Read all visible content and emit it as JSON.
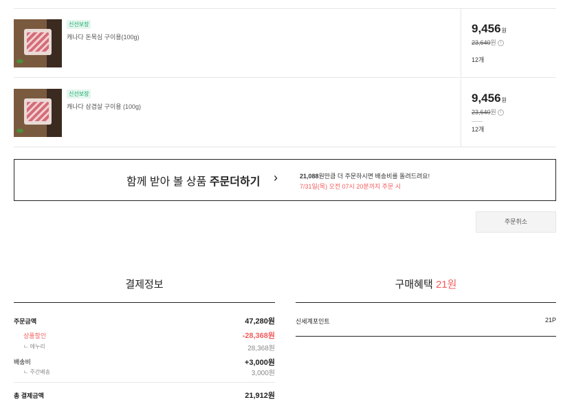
{
  "products": [
    {
      "badge": "신선보장",
      "name": "캐나다 돈목심 구이용(100g)",
      "price": "9,456",
      "price_unit": "원",
      "original_price": "23,640",
      "original_unit": "원",
      "info_icon": "i",
      "quantity": "12개"
    },
    {
      "badge": "신선보장",
      "name": "캐나다 삼겹살 구이용 (100g)",
      "price": "9,456",
      "price_unit": "원",
      "original_price": "23,640",
      "original_unit": "원",
      "info_icon": "i",
      "quantity": "12개"
    }
  ],
  "add_order": {
    "text_prefix": "함께 받아 볼 상품 ",
    "text_bold": "주문더하기",
    "arrow": "›",
    "amount": "21,088",
    "info_suffix": "원만큼 더 주문하시면 배송비를 돌려드려요!",
    "deadline": "7/31일(목) 오전 07시 20분까지 주문 시"
  },
  "cancel_button": "주문취소",
  "payment": {
    "title": "결제정보",
    "order_amount_label": "주문금액",
    "order_amount_value": "47,280원",
    "discount_label": "상품할인",
    "discount_value": "-28,368원",
    "discount_sub_label": "ㄴ 에누리",
    "discount_sub_value": "28,368원",
    "shipping_label": "배송비",
    "shipping_value": "+3,000원",
    "shipping_sub_label": "ㄴ 주간배송",
    "shipping_sub_value": "3,000원",
    "total_label": "총 결제금액",
    "total_value": "21,912원"
  },
  "benefit": {
    "title_prefix": "구매혜택 ",
    "title_amount": "21원",
    "point_label": "신세계포인트",
    "point_value": "21P"
  },
  "colors": {
    "accent_red": "#f25c5c",
    "badge_green": "#0fa765",
    "badge_bg": "#e5f6ee"
  }
}
